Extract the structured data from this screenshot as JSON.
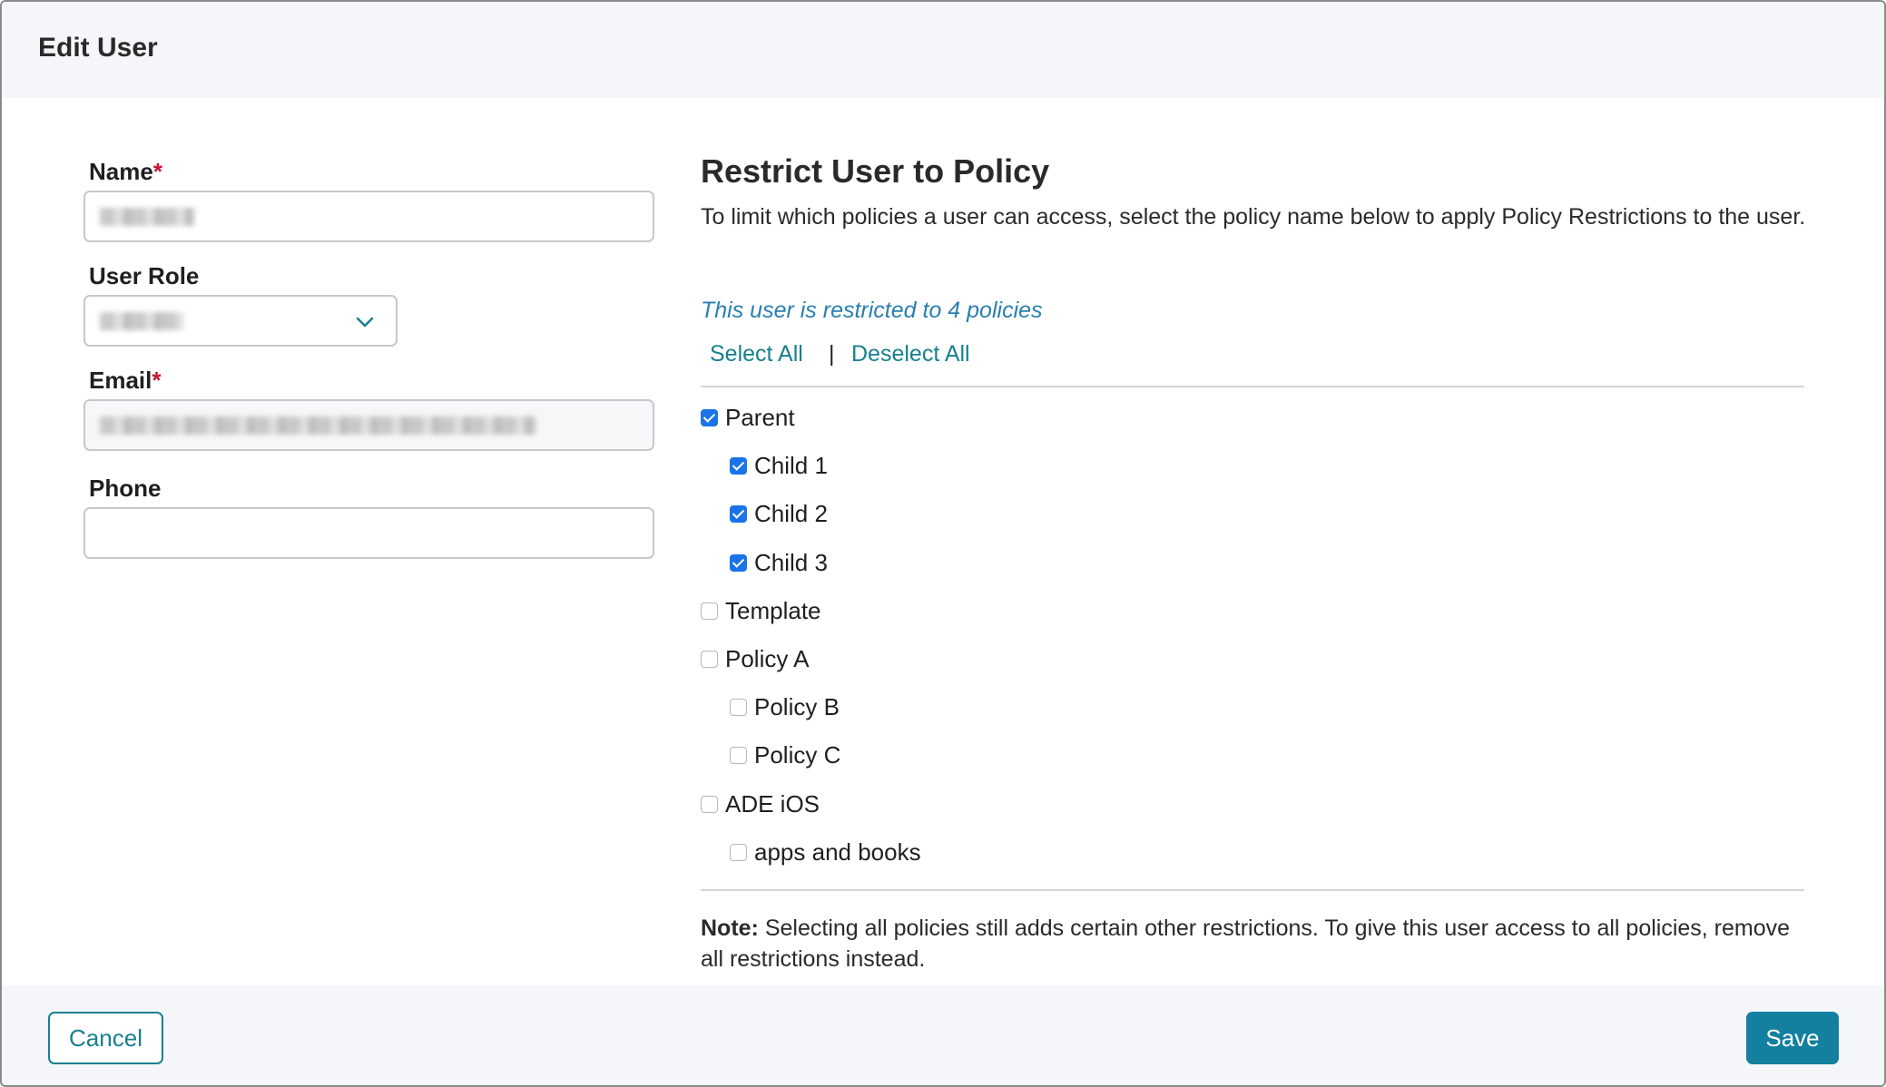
{
  "dialog": {
    "title": "Edit User"
  },
  "form": {
    "name": {
      "label": "Name",
      "required_marker": "*",
      "value": ""
    },
    "role": {
      "label": "User Role",
      "selected": ""
    },
    "email": {
      "label": "Email",
      "required_marker": "*",
      "value": ""
    },
    "phone": {
      "label": "Phone",
      "value": ""
    }
  },
  "restrictions": {
    "title": "Restrict User to Policy",
    "description": "To limit which policies a user can access, select the policy name below to apply Policy Restrictions to the user.",
    "status": "This user is restricted to 4 policies",
    "select_all": "Select All",
    "separator": "|",
    "deselect_all": "Deselect All",
    "policies": [
      {
        "label": "Parent",
        "checked": true,
        "level": 0
      },
      {
        "label": "Child 1",
        "checked": true,
        "level": 1
      },
      {
        "label": "Child 2",
        "checked": true,
        "level": 1
      },
      {
        "label": "Child 3",
        "checked": true,
        "level": 1
      },
      {
        "label": "Template",
        "checked": false,
        "level": 0
      },
      {
        "label": "Policy A",
        "checked": false,
        "level": 0
      },
      {
        "label": "Policy B",
        "checked": false,
        "level": 1
      },
      {
        "label": "Policy C",
        "checked": false,
        "level": 1
      },
      {
        "label": "ADE iOS",
        "checked": false,
        "level": 0
      },
      {
        "label": "apps and books",
        "checked": false,
        "level": 1
      }
    ],
    "note_label": "Note:",
    "note_text": " Selecting all policies still adds certain other restrictions. To give this user access to all policies, remove all restrictions instead."
  },
  "footer": {
    "cancel": "Cancel",
    "save": "Save"
  },
  "colors": {
    "accent": "#17808f",
    "save_bg": "#1380a0",
    "checkbox_checked": "#1a73e8",
    "required": "#c8102e",
    "status_text": "#2a7fb0"
  }
}
